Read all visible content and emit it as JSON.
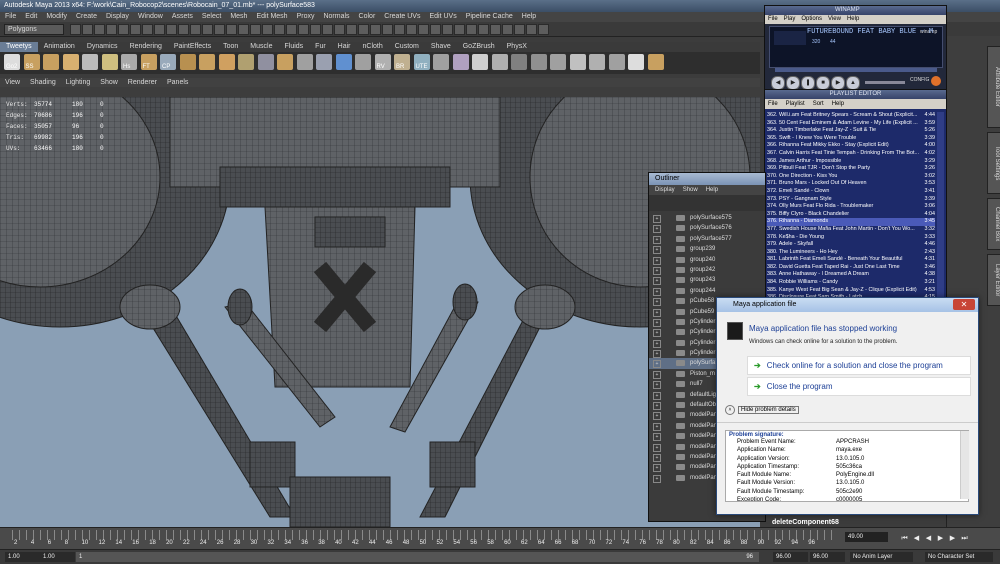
{
  "maya": {
    "title": "Autodesk Maya 2013 x64: F:\\work\\Cain_Robocop2\\scenes\\Robocain_07_01.mb*    ---    polySurface583",
    "menus": [
      "File",
      "Edit",
      "Modify",
      "Create",
      "Display",
      "Window",
      "Assets",
      "Select",
      "Mesh",
      "Edit Mesh",
      "Proxy",
      "Normals",
      "Color",
      "Create UVs",
      "Edit UVs",
      "Pipeline Cache",
      "Help"
    ],
    "mode": "Polygons",
    "shelf_tabs": [
      "Tweetys",
      "Animation",
      "Dynamics",
      "Rendering",
      "PaintEffects",
      "Toon",
      "Muscle",
      "Fluids",
      "Fur",
      "Hair",
      "nCloth",
      "Custom",
      "Shave",
      "GoZBrush",
      "PhysX"
    ],
    "active_shelf": "Tweetys",
    "shelf_labels": [
      "Go2",
      "SS",
      "Hs",
      "FT",
      "CP",
      "RV",
      "BR",
      "UTE"
    ],
    "panel_menus": [
      "View",
      "Shading",
      "Lighting",
      "Show",
      "Renderer",
      "Panels"
    ],
    "hud": [
      {
        "key": "Verts:",
        "a": "35774",
        "b": "180",
        "c": "0"
      },
      {
        "key": "Edges:",
        "a": "70686",
        "b": "196",
        "c": "0"
      },
      {
        "key": "Faces:",
        "a": "35057",
        "b": "96",
        "c": "0"
      },
      {
        "key": "Tris:",
        "a": "69982",
        "b": "196",
        "c": "0"
      },
      {
        "key": "UVs:",
        "a": "63466",
        "b": "180",
        "c": "0"
      }
    ],
    "right_tabs": [
      "Attribute Editor",
      "Tool Settings",
      "Channel Box",
      "Layer Editor"
    ]
  },
  "winamp": {
    "title": "WINAMP",
    "menus": [
      "File",
      "Play",
      "Options",
      "View",
      "Help"
    ],
    "marquee": "FUTUREBOUND FEAT BABY BLUE - M",
    "kbps": "320",
    "khz": "44",
    "config_label": "CONFIG",
    "time_label": "winamp"
  },
  "playlist": {
    "title": "PLAYLIST EDITOR",
    "menus": [
      "File",
      "Playlist",
      "Sort",
      "Help"
    ],
    "items": [
      {
        "n": "362. Will.i.am Feat Britney Spears - Scream & Shout (Explicit...",
        "t": "4:44"
      },
      {
        "n": "363. 50 Cent Feat Eminem & Adam Levine - My Life (Explicit ...",
        "t": "3:59"
      },
      {
        "n": "364. Justin Timberlake Feat Jay-Z - Suit & Tie",
        "t": "5:26"
      },
      {
        "n": "365. Swift - I Knew You Were Trouble",
        "t": "3:39"
      },
      {
        "n": "366. Rihanna Feat Mikky Ekko - Stay (Explicit Edit)",
        "t": "4:00"
      },
      {
        "n": "367. Calvin Harris Feat Tinie Tempah - Drinking From The Bot...",
        "t": "4:02"
      },
      {
        "n": "368. James Arthur - Impossible",
        "t": "3:29"
      },
      {
        "n": "369. Pitbull Feat TJR - Don't Stop the Party",
        "t": "3:26"
      },
      {
        "n": "370. One Direction - Kiss You",
        "t": "3:02"
      },
      {
        "n": "371. Bruno Mars - Locked Out Of Heaven",
        "t": "3:53"
      },
      {
        "n": "372. Emeli Sandé - Clown",
        "t": "3:41"
      },
      {
        "n": "373. PSY - Gangnam Style",
        "t": "3:39"
      },
      {
        "n": "374. Olly Murs Feat Flo Rida - Troublemaker",
        "t": "3:06"
      },
      {
        "n": "375. Biffy Clyro - Black Chandelier",
        "t": "4:04"
      },
      {
        "n": "376. Rihanna - Diamonds",
        "t": "3:45"
      },
      {
        "n": "377. Swedish House Mafia Feat John Martin - Don't You Wo...",
        "t": "3:32"
      },
      {
        "n": "378. Ke$ha - Die Young",
        "t": "3:33"
      },
      {
        "n": "379. Adele - Skyfall",
        "t": "4:46"
      },
      {
        "n": "380. The Lumineers - Ho Hey",
        "t": "2:43"
      },
      {
        "n": "381. Labrinth Feat Emeli Sandé - Beneath Your Beautiful",
        "t": "4:31"
      },
      {
        "n": "382. David Guetta Feat Taped Rai - Just One Last Time",
        "t": "3:46"
      },
      {
        "n": "383. Anne Hathaway - I Dreamed A Dream",
        "t": "4:38"
      },
      {
        "n": "384. Robbie Williams - Candy",
        "t": "3:21"
      },
      {
        "n": "385. Kanye West Feat Big Sean & Jay-Z - Clique (Explicit Edit)",
        "t": "4:53"
      },
      {
        "n": "386. Disclosure Feat Sam Smith - Latch",
        "t": "4:15"
      }
    ],
    "selected_index": 14
  },
  "outliner": {
    "title": "Outliner",
    "menus": [
      "Display",
      "Show",
      "Help"
    ],
    "items": [
      "polySurface575",
      "polySurface576",
      "polySurface577",
      "group239",
      "group240",
      "group242",
      "group243",
      "group244",
      "pCube58",
      "pCube59",
      "pCylinder",
      "pCylinder",
      "pCylinder",
      "pCylinder",
      "polySurfa",
      "Piston_m",
      "null7",
      "defaultLig",
      "defaultOb",
      "modelPane",
      "modelPane",
      "modelPane",
      "modelPane",
      "modelPane",
      "modelPane",
      "modelPane"
    ],
    "selected_index": 14
  },
  "crash": {
    "title": "Maya application file",
    "heading": "Maya application file has stopped working",
    "subtext": "Windows can check online for a solution to the problem.",
    "option1": "Check online for a solution and close the program",
    "option2": "Close the program",
    "hide_details": "Hide problem details",
    "sig_header": "Problem signature:",
    "signature": [
      {
        "k": "Problem Event Name:",
        "v": "APPCRASH"
      },
      {
        "k": "Application Name:",
        "v": "maya.exe"
      },
      {
        "k": "Application Version:",
        "v": "13.0.105.0"
      },
      {
        "k": "Application Timestamp:",
        "v": "505c36ca"
      },
      {
        "k": "Fault Module Name:",
        "v": "PolyEngine.dll"
      },
      {
        "k": "Fault Module Version:",
        "v": "13.0.105.0"
      },
      {
        "k": "Fault Module Timestamp:",
        "v": "505c2e90"
      },
      {
        "k": "Exception Code:",
        "v": "c0000005"
      }
    ]
  },
  "timeline": {
    "ticks": [
      "2",
      "4",
      "6",
      "8",
      "10",
      "12",
      "14",
      "16",
      "18",
      "20",
      "22",
      "24",
      "26",
      "28",
      "30",
      "32",
      "34",
      "36",
      "38",
      "40",
      "42",
      "44",
      "46",
      "48",
      "50",
      "52",
      "54",
      "56",
      "58",
      "60",
      "62",
      "64",
      "66",
      "68",
      "70",
      "72",
      "74",
      "76",
      "78",
      "80",
      "82",
      "84",
      "86",
      "88",
      "90",
      "92",
      "94",
      "96"
    ],
    "current_frame": "49.00",
    "status": "deleteComponent68"
  },
  "range": {
    "start": "1.00",
    "start2": "1.00",
    "slider_start": "1",
    "slider_end": "96",
    "end": "96.00",
    "end2": "96.00",
    "anim_layer": "No Anim Layer",
    "char_set": "No Character Set"
  }
}
